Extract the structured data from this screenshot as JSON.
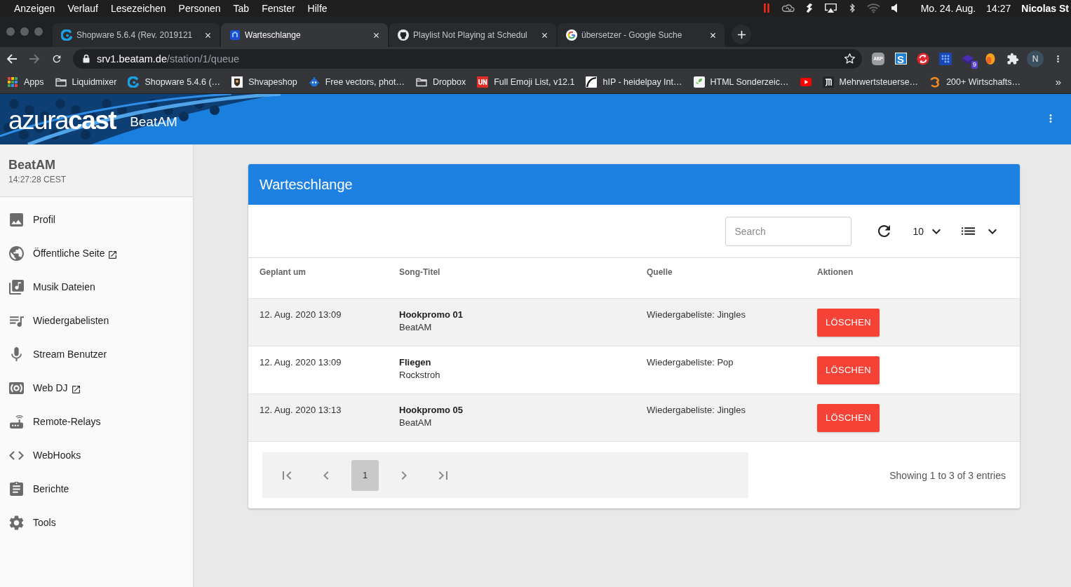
{
  "menu_bar": {
    "items": [
      "Anzeigen",
      "Verlauf",
      "Lesezeichen",
      "Personen",
      "Tab",
      "Fenster",
      "Hilfe"
    ],
    "date": "Mo. 24. Aug.",
    "time": "14:27",
    "user": "Nicolas St"
  },
  "browser": {
    "tabs": [
      {
        "title": "Shopware 5.6.4 (Rev. 2019121",
        "selected": false
      },
      {
        "title": "Warteschlange",
        "selected": true
      },
      {
        "title": "Playlist Not Playing at Schedul",
        "selected": false
      },
      {
        "title": "übersetzer - Google Suche",
        "selected": false
      }
    ],
    "nav_buttons": [
      {
        "kind": "back",
        "disabled": false
      },
      {
        "kind": "forward",
        "disabled": true
      },
      {
        "kind": "reload",
        "disabled": false
      }
    ],
    "url": {
      "host": "srv1.beatam.de",
      "path": "/station/1/queue"
    },
    "extensions": {
      "adblock": "ABP",
      "letter": "S",
      "badge": "9"
    },
    "profile_initial": "N",
    "bookmarks": [
      {
        "kind": "apps",
        "label": "Apps"
      },
      {
        "kind": "folder",
        "label": "Liquidmixer"
      },
      {
        "kind": "site",
        "label": "Shopware 5.4.6 (…"
      },
      {
        "kind": "site",
        "label": "Shvapeshop"
      },
      {
        "kind": "site",
        "label": "Free vectors, phot…"
      },
      {
        "kind": "folder",
        "label": "Dropbox"
      },
      {
        "kind": "site",
        "label": "Full Emoji List, v12.1"
      },
      {
        "kind": "site",
        "label": "hIP - heidelpay Int…"
      },
      {
        "kind": "site",
        "label": "HTML Sonderzeic…"
      },
      {
        "kind": "site"
      },
      {
        "kind": "site",
        "label": "Mehrwertsteuerse…"
      },
      {
        "kind": "site",
        "label": "200+ Wirtschafts…"
      }
    ],
    "bookmarks_overflow": "»"
  },
  "app_header": {
    "logo": "azura**cast**",
    "station": "BeatAM"
  },
  "sidebar": {
    "station": "BeatAM",
    "time": "14:27:28 CEST",
    "nav": [
      {
        "label": "Profil",
        "external": false
      },
      {
        "label": "Öffentliche Seite",
        "external": true
      },
      {
        "label": "Musik Dateien",
        "external": false
      },
      {
        "label": "Wiedergabelisten",
        "external": false
      },
      {
        "label": "Stream Benutzer",
        "external": false
      },
      {
        "label": "Web DJ",
        "external": true
      },
      {
        "label": "Remote-Relays",
        "external": false
      },
      {
        "label": "WebHooks",
        "external": false
      },
      {
        "label": "Berichte",
        "external": false
      },
      {
        "label": "Tools",
        "external": false
      }
    ]
  },
  "queue": {
    "title": "Warteschlange",
    "search_placeholder": "Search",
    "per_page": "10",
    "columns": [
      "Geplant um",
      "Song-Titel",
      "Quelle",
      "Aktionen"
    ],
    "rows": [
      {
        "scheduled": "12. Aug. 2020 13:09",
        "title": "Hookpromo 01",
        "artist": "BeatAM",
        "source": "Wiedergabeliste: Jingles",
        "action": "LÖSCHEN"
      },
      {
        "scheduled": "12. Aug. 2020 13:09",
        "title": "Fliegen",
        "artist": "Rockstroh",
        "source": "Wiedergabeliste: Pop",
        "action": "LÖSCHEN"
      },
      {
        "scheduled": "12. Aug. 2020 13:13",
        "title": "Hookpromo 05",
        "artist": "BeatAM",
        "source": "Wiedergabeliste: Jingles",
        "action": "LÖSCHEN"
      }
    ],
    "pagination": {
      "pages": [
        {
          "label": "1",
          "selected": true
        }
      ],
      "summary": "Showing 1 to 3 of 3 entries"
    }
  }
}
